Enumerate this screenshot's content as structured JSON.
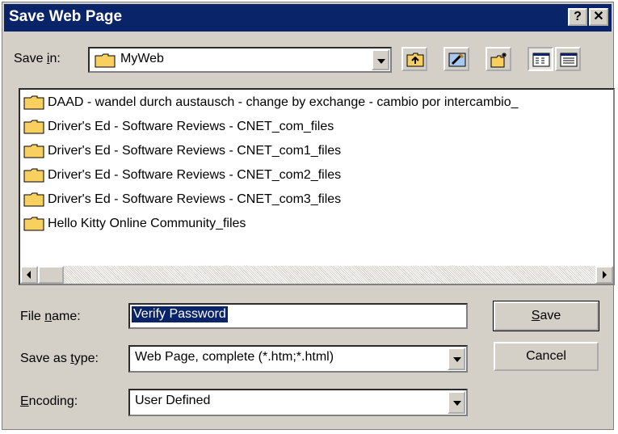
{
  "window": {
    "title": "Save Web Page",
    "help_glyph": "?",
    "close_glyph": "✕"
  },
  "save_in": {
    "label_pre": "Save ",
    "label_key": "i",
    "label_post": "n:",
    "value": "MyWeb"
  },
  "files": [
    "DAAD - wandel durch austausch - change by exchange - cambio por intercambio_",
    "Driver's Ed - Software Reviews - CNET_com_files",
    "Driver's Ed - Software Reviews - CNET_com1_files",
    "Driver's Ed - Software Reviews - CNET_com2_files",
    "Driver's Ed - Software Reviews - CNET_com3_files",
    "Hello Kitty Online Community_files"
  ],
  "file_name": {
    "label_pre": "File ",
    "label_key": "n",
    "label_post": "ame:",
    "value": "Verify Password"
  },
  "save_as_type": {
    "label_pre": "Save as ",
    "label_key": "t",
    "label_post": "ype:",
    "value": "Web Page, complete (*.htm;*.html)"
  },
  "encoding": {
    "label_pre": "",
    "label_key": "E",
    "label_post": "ncoding:",
    "value": "User Defined"
  },
  "buttons": {
    "save_key": "S",
    "save_rest": "ave",
    "cancel": "Cancel"
  },
  "colors": {
    "title_bar": "#0a246a",
    "dialog_bg": "#d4d0c8",
    "selection": "#0a246a",
    "folder": "#f8d060"
  }
}
